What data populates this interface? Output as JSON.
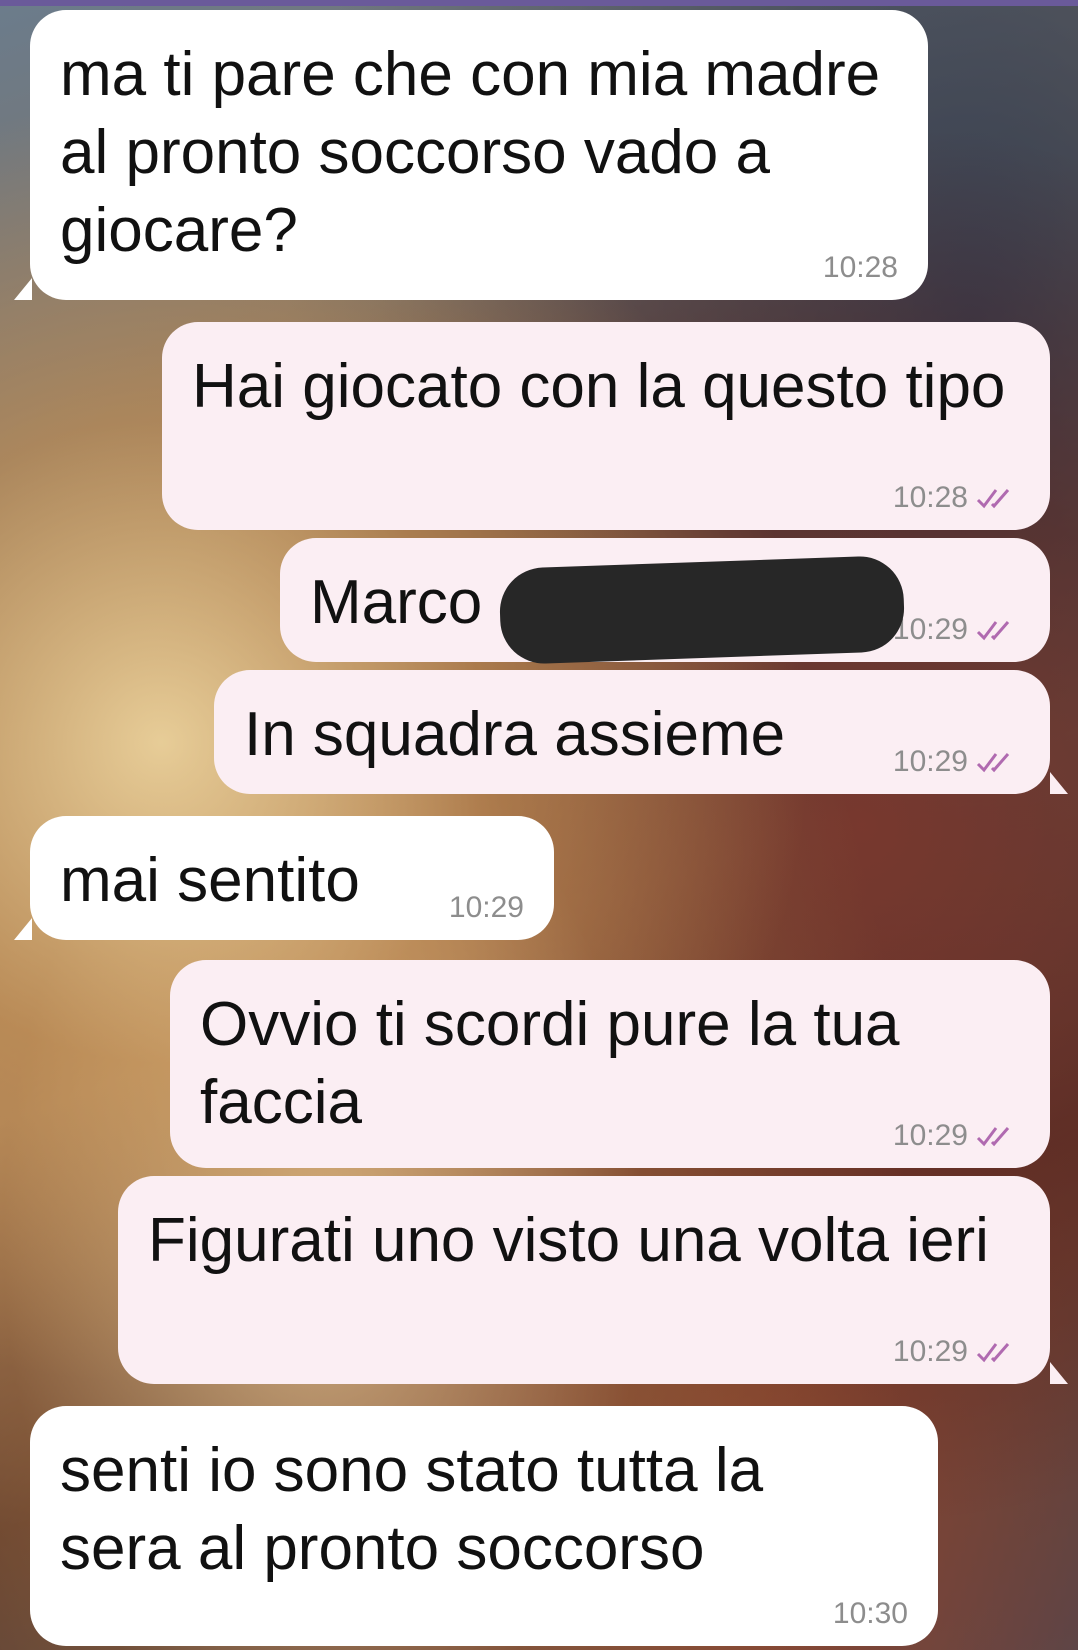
{
  "messages": [
    {
      "direction": "in",
      "text": "ma ti pare che con mia madre al pronto soccorso vado a giocare?",
      "time": "10:28"
    },
    {
      "direction": "out",
      "text": "Hai giocato con la questo tipo",
      "time": "10:28",
      "status": "read"
    },
    {
      "direction": "out",
      "text": "Marco",
      "time": "10:29",
      "status": "read",
      "redacted": true
    },
    {
      "direction": "out",
      "text": "In squadra assieme",
      "time": "10:29",
      "status": "read"
    },
    {
      "direction": "in",
      "text": "mai sentito",
      "time": "10:29"
    },
    {
      "direction": "out",
      "text": "Ovvio ti scordi pure la tua faccia",
      "time": "10:29",
      "status": "read"
    },
    {
      "direction": "out",
      "text": "Figurati uno visto una volta ieri",
      "time": "10:29",
      "status": "read"
    },
    {
      "direction": "in",
      "text": "senti io sono stato tutta la sera al pronto soccorso",
      "time": "10:30"
    }
  ],
  "colors": {
    "incoming_bubble": "#ffffff",
    "outgoing_bubble": "#fbeef3",
    "read_check": "#b06ab0",
    "timestamp": "#8d8d8d"
  },
  "icons": {
    "read_receipt": "double-check-icon"
  }
}
